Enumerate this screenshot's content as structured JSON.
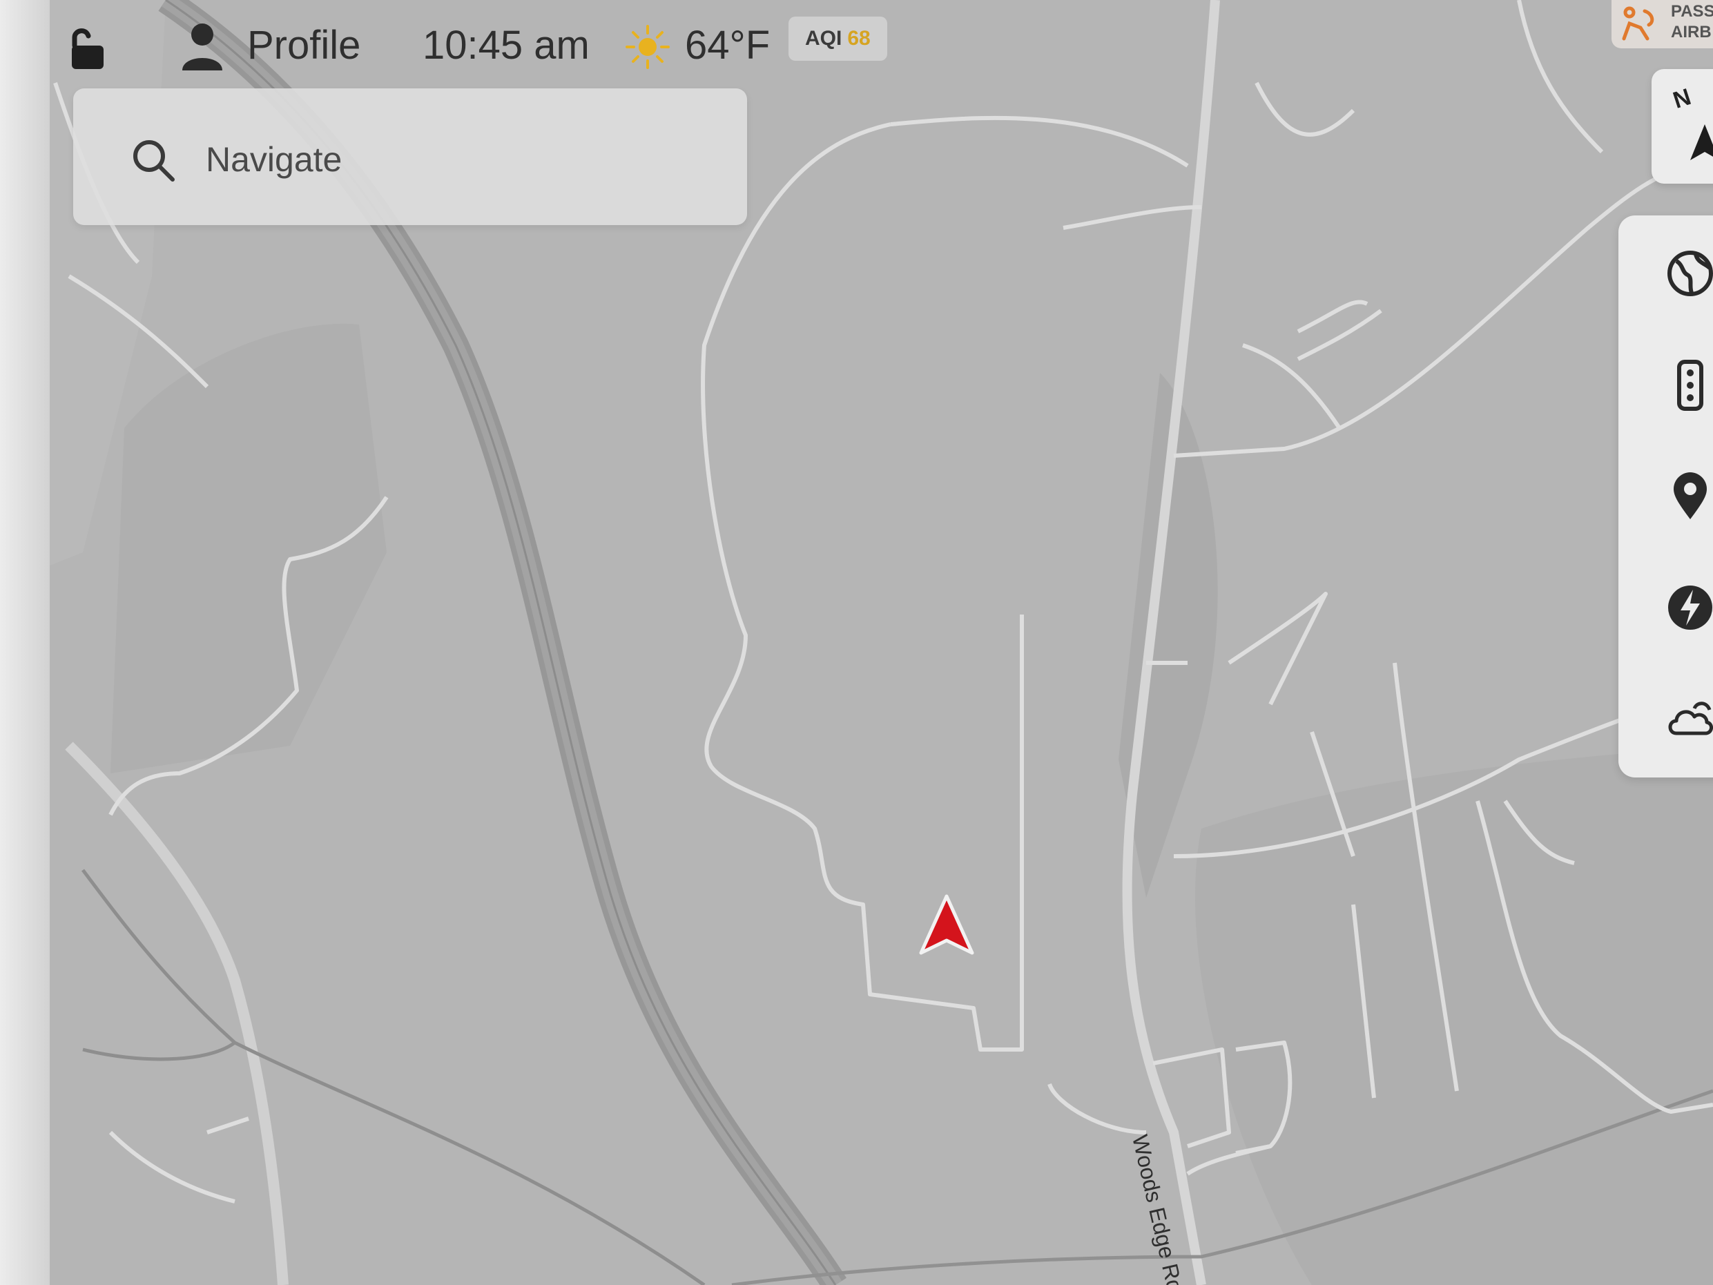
{
  "status_bar": {
    "lock_icon": "unlocked-padlock-icon",
    "profile_icon": "person-icon",
    "profile_label": "Profile",
    "time": "10:45 am",
    "weather_icon": "sun-icon",
    "temperature": "64°F",
    "aqi_label": "AQI",
    "aqi_value": "68",
    "aqi_value_color": "#d6a422"
  },
  "search": {
    "icon": "search-icon",
    "placeholder": "Navigate"
  },
  "airbag_indicator": {
    "icon": "passenger-airbag-icon",
    "line1": "PASS",
    "line2": "AIRB"
  },
  "map": {
    "road_label": "Woods Edge Rd",
    "vehicle_marker_color": "#d4141c",
    "compass_label": "N"
  },
  "toolbar": {
    "items": [
      {
        "icon": "globe-icon"
      },
      {
        "icon": "traffic-light-icon"
      },
      {
        "icon": "location-pin-icon"
      },
      {
        "icon": "charging-bolt-icon"
      },
      {
        "icon": "weather-cloud-icon"
      }
    ]
  }
}
